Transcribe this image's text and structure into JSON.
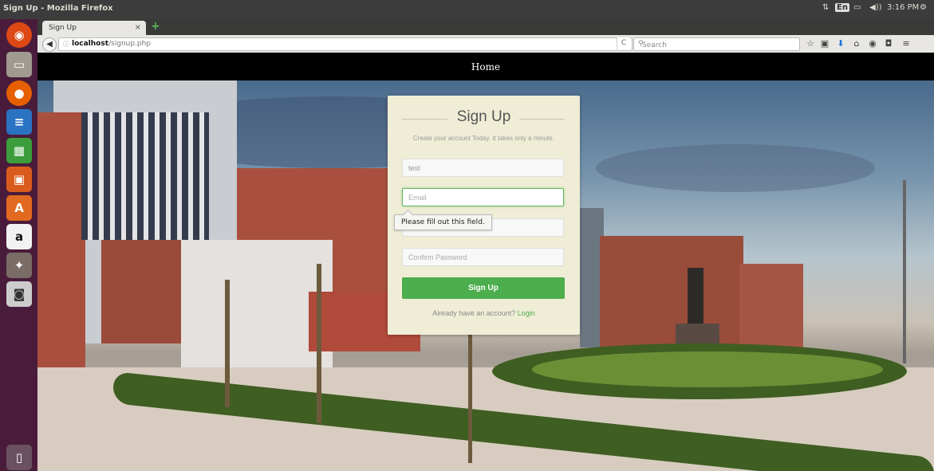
{
  "system": {
    "window_title": "Sign Up - Mozilla Firefox",
    "indicators": {
      "lang": "En",
      "volume": "◀))",
      "time": "3:16 PM"
    }
  },
  "browser": {
    "tab_title": "Sign Up",
    "tab_close": "×",
    "new_tab": "+",
    "url_host": "localhost",
    "url_path": "/signup.php",
    "search_placeholder": "Search"
  },
  "site": {
    "nav_home": "Home"
  },
  "signup": {
    "title": "Sign Up",
    "subtitle": "Create your account Today. It takes only a minute.",
    "fields": {
      "name_value": "test",
      "email_placeholder": "Email",
      "password_placeholder": "Password",
      "confirm_placeholder": "Confirm Password"
    },
    "submit_label": "Sign Up",
    "already_text": "Already have an account?",
    "login_link": "Login",
    "validation_tooltip": "Please fill out this field."
  },
  "colors": {
    "accent_green": "#4cae4c",
    "launcher_bg": "#4a1c3b",
    "card_bg": "#f0edd6"
  }
}
